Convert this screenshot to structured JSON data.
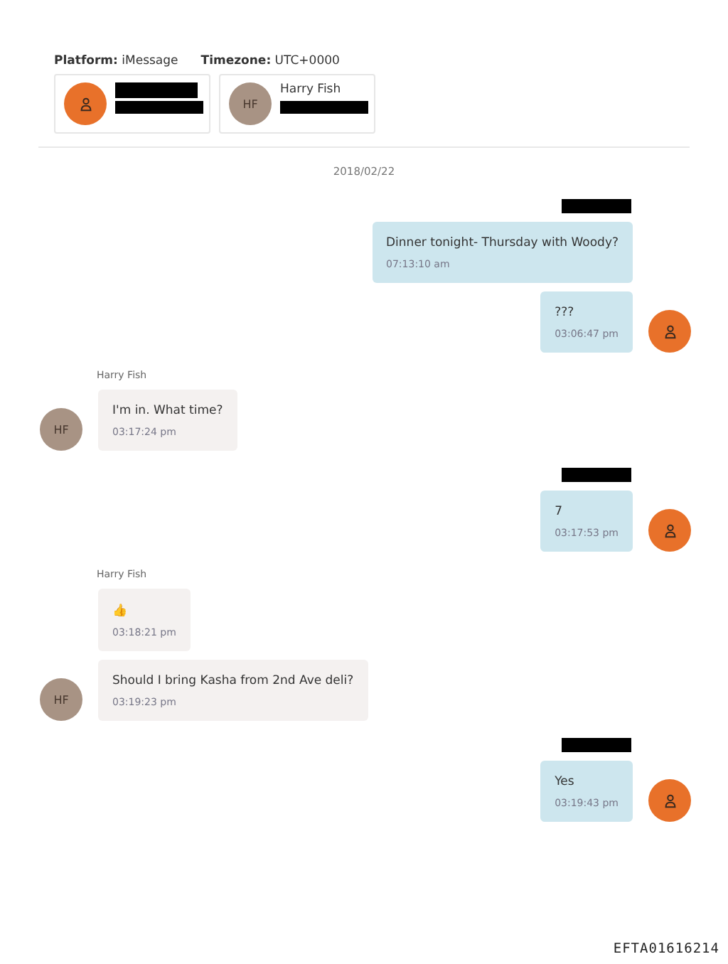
{
  "meta": {
    "platform_label": "Platform:",
    "platform": "iMessage",
    "timezone_label": "Timezone:",
    "timezone": "UTC+0000"
  },
  "participants": [
    {
      "kind": "user",
      "name_redacted": true,
      "detail_redacted": true
    },
    {
      "kind": "contact",
      "initials": "HF",
      "name": "Harry Fish",
      "name_redacted": false,
      "detail_redacted": true
    }
  ],
  "date": "2018/02/22",
  "messages": [
    {
      "kind": "outgoing",
      "sender_redacted": true,
      "text": "Dinner tonight- Thursday with Woody?",
      "time": "07:13:10 am",
      "avatar": false
    },
    {
      "kind": "outgoing",
      "sender_redacted": false,
      "text": "???",
      "time": "03:06:47 pm",
      "avatar": true
    },
    {
      "kind": "incoming",
      "sender": "Harry Fish",
      "sender_redacted": false,
      "text": "I'm in. What time?",
      "time": "03:17:24 pm",
      "avatar": true,
      "initials": "HF"
    },
    {
      "kind": "outgoing",
      "sender_redacted": true,
      "text": "7",
      "time": "03:17:53 pm",
      "avatar": true
    },
    {
      "kind": "incoming",
      "sender": "Harry Fish",
      "sender_redacted": false,
      "text": "👍",
      "time": "03:18:21 pm",
      "avatar": false
    },
    {
      "kind": "incoming",
      "sender_redacted": false,
      "text": "Should I bring Kasha from 2nd Ave deli?",
      "time": "03:19:23 pm",
      "avatar": true,
      "initials": "HF"
    },
    {
      "kind": "outgoing",
      "sender_redacted": true,
      "text": "Yes",
      "time": "03:19:43 pm",
      "avatar": true
    }
  ],
  "footer": "EFTA01616214"
}
